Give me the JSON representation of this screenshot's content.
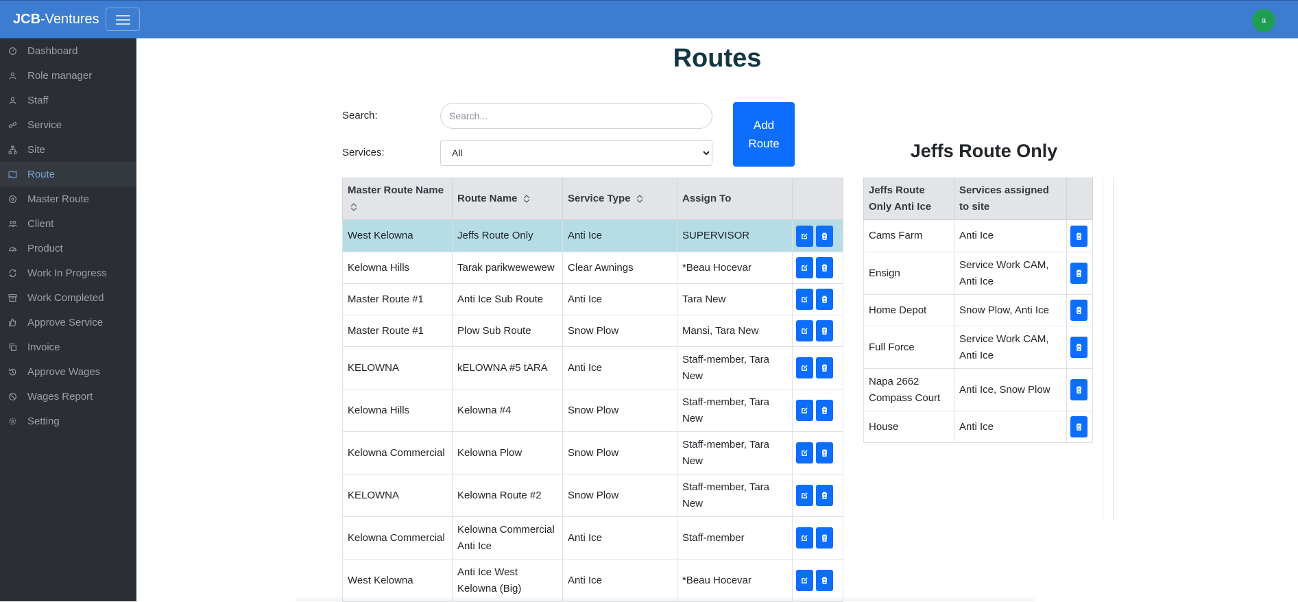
{
  "header": {
    "brand_bold": "JCB",
    "brand_rest": "-Ventures",
    "avatar_letter": "a"
  },
  "sidebar": {
    "items": [
      {
        "label": "Dashboard",
        "icon": "dashboard-icon"
      },
      {
        "label": "Role manager",
        "icon": "user-icon"
      },
      {
        "label": "Staff",
        "icon": "user-icon"
      },
      {
        "label": "Service",
        "icon": "link-icon"
      },
      {
        "label": "Site",
        "icon": "sitemap-icon"
      },
      {
        "label": "Route",
        "icon": "map-icon",
        "active": true
      },
      {
        "label": "Master Route",
        "icon": "target-icon"
      },
      {
        "label": "Client",
        "icon": "users-icon"
      },
      {
        "label": "Product",
        "icon": "gauge-icon"
      },
      {
        "label": "Work In Progress",
        "icon": "refresh-icon"
      },
      {
        "label": "Work Completed",
        "icon": "archive-icon"
      },
      {
        "label": "Approve Service",
        "icon": "thumbs-up-icon"
      },
      {
        "label": "Invoice",
        "icon": "copy-icon"
      },
      {
        "label": "Approve Wages",
        "icon": "history-icon"
      },
      {
        "label": "Wages Report",
        "icon": "ban-icon"
      },
      {
        "label": "Setting",
        "icon": "gear-icon"
      }
    ]
  },
  "main": {
    "title": "Routes",
    "search_label": "Search:",
    "search_placeholder": "Search...",
    "services_label": "Services:",
    "services_selected": "All",
    "add_button": "Add Route"
  },
  "routes_table": {
    "headers": [
      "Master Route Name",
      "Route Name",
      "Service Type",
      "Assign To"
    ],
    "rows": [
      {
        "master": "West Kelowna",
        "route": "Jeffs Route Only",
        "service": "Anti Ice",
        "assign": "SUPERVISOR",
        "selected": true
      },
      {
        "master": "Kelowna Hills",
        "route": "Tarak parikwewewew",
        "service": "Clear Awnings",
        "assign": "*Beau Hocevar"
      },
      {
        "master": "Master Route #1",
        "route": "Anti Ice Sub Route",
        "service": "Anti Ice",
        "assign": "Tara New"
      },
      {
        "master": "Master Route #1",
        "route": "Plow Sub Route",
        "service": "Snow Plow",
        "assign": "Mansi, Tara New"
      },
      {
        "master": "KELOWNA",
        "route": "kELOWNA #5 tARA",
        "service": "Anti Ice",
        "assign": "Staff-member, Tara New"
      },
      {
        "master": "Kelowna Hills",
        "route": "Kelowna #4",
        "service": "Snow Plow",
        "assign": "Staff-member, Tara New"
      },
      {
        "master": "Kelowna Commercial",
        "route": "Kelowna Plow",
        "service": "Snow Plow",
        "assign": "Staff-member, Tara New"
      },
      {
        "master": "KELOWNA",
        "route": "Kelowna Route #2",
        "service": "Snow Plow",
        "assign": "Staff-member, Tara New"
      },
      {
        "master": "Kelowna Commercial",
        "route": "Kelowna Commercial Anti Ice",
        "service": "Anti Ice",
        "assign": "Staff-member"
      },
      {
        "master": "West Kelowna",
        "route": "Anti Ice West Kelowna (Big)",
        "service": "Anti Ice",
        "assign": "*Beau Hocevar"
      }
    ]
  },
  "sites_panel": {
    "title": "Jeffs Route Only",
    "headers": [
      "Jeffs Route Only Anti Ice",
      "Services assigned to site"
    ],
    "rows": [
      {
        "site": "Cams Farm",
        "services": "Anti Ice"
      },
      {
        "site": "Ensign",
        "services": "Service Work CAM, Anti Ice"
      },
      {
        "site": "Home Depot",
        "services": "Snow Plow, Anti Ice"
      },
      {
        "site": "Full Force",
        "services": "Service Work CAM, Anti Ice"
      },
      {
        "site": "Napa 2662 Compass Court",
        "services": "Anti Ice, Snow Plow"
      },
      {
        "site": "House",
        "services": "Anti Ice"
      }
    ]
  },
  "colors": {
    "topbar": "#3c7dd1",
    "sidebar": "#2b2f34",
    "primary": "#0d6efd",
    "selected_row": "#b6dde6",
    "title": "#123744"
  }
}
